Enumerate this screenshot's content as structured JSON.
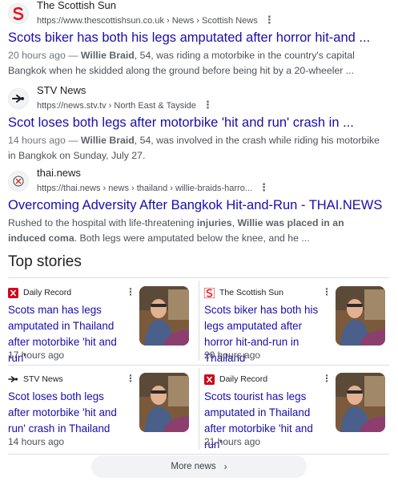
{
  "results": [
    {
      "source": "The Scottish Sun",
      "url": "https://www.thescottishsun.co.uk › News › Scottish News",
      "icon": "scottish-sun-logo",
      "title": "Scots biker has both his legs amputated after horror hit-and ...",
      "date": "20 hours ago — ",
      "bold": "Willie Braid",
      "snippet_rest": ", 54, was riding a motorbike in the country's capital Bangkok when he skidded along the ground before being hit by a 20-wheeler ..."
    },
    {
      "source": "STV News",
      "url": "https://news.stv.tv › North East & Tayside",
      "icon": "stv-logo",
      "title": "Scot loses both legs after motorbike 'hit and run' crash in ...",
      "date": "14 hours ago — ",
      "bold": "Willie Braid",
      "snippet_rest": ", 54, was involved in the crash while riding his motorbike in Bangkok on Sunday, July 27."
    },
    {
      "source": "thai.news",
      "url": "https://thai.news › news › thailand › willie-braids-harro...",
      "icon": "thai-news-logo",
      "title": "Overcoming Adversity After Bangkok Hit-and-Run - THAI.NEWS",
      "snippet_a": "Rushed to the hospital with life-threatening ",
      "bold_a": "injuries",
      "snippet_b": ", ",
      "bold_b": "Willie was placed in an induced coma",
      "snippet_c": ". Both legs were amputated below the knee, and he ..."
    }
  ],
  "top_stories": {
    "heading": "Top stories",
    "items": [
      {
        "source": "Daily Record",
        "icon": "daily-record-logo",
        "title": "Scots man has legs amputated in Thailand after motorbike 'hit and run'",
        "time": "17 hours ago"
      },
      {
        "source": "The Scottish Sun",
        "icon": "scottish-sun-logo",
        "title": "Scots biker has both his legs amputated after horror hit-and-run in Thailand",
        "time": "20 hours ago"
      },
      {
        "source": "STV News",
        "icon": "stv-logo",
        "title": "Scot loses both legs after motorbike 'hit and run' crash in Thailand",
        "time": "14 hours ago"
      },
      {
        "source": "Daily Record",
        "icon": "daily-record-logo",
        "title": "Scots tourist has legs amputated in Thailand after motorbike 'hit and run'",
        "time": "21 hours ago"
      }
    ]
  },
  "more_news": {
    "label": "More news",
    "icon": "chevron-right-icon"
  },
  "colors": {
    "link": "#1a0dab",
    "text": "#4d5156",
    "sun_red": "#e5161d",
    "record_red": "#d0021b"
  }
}
